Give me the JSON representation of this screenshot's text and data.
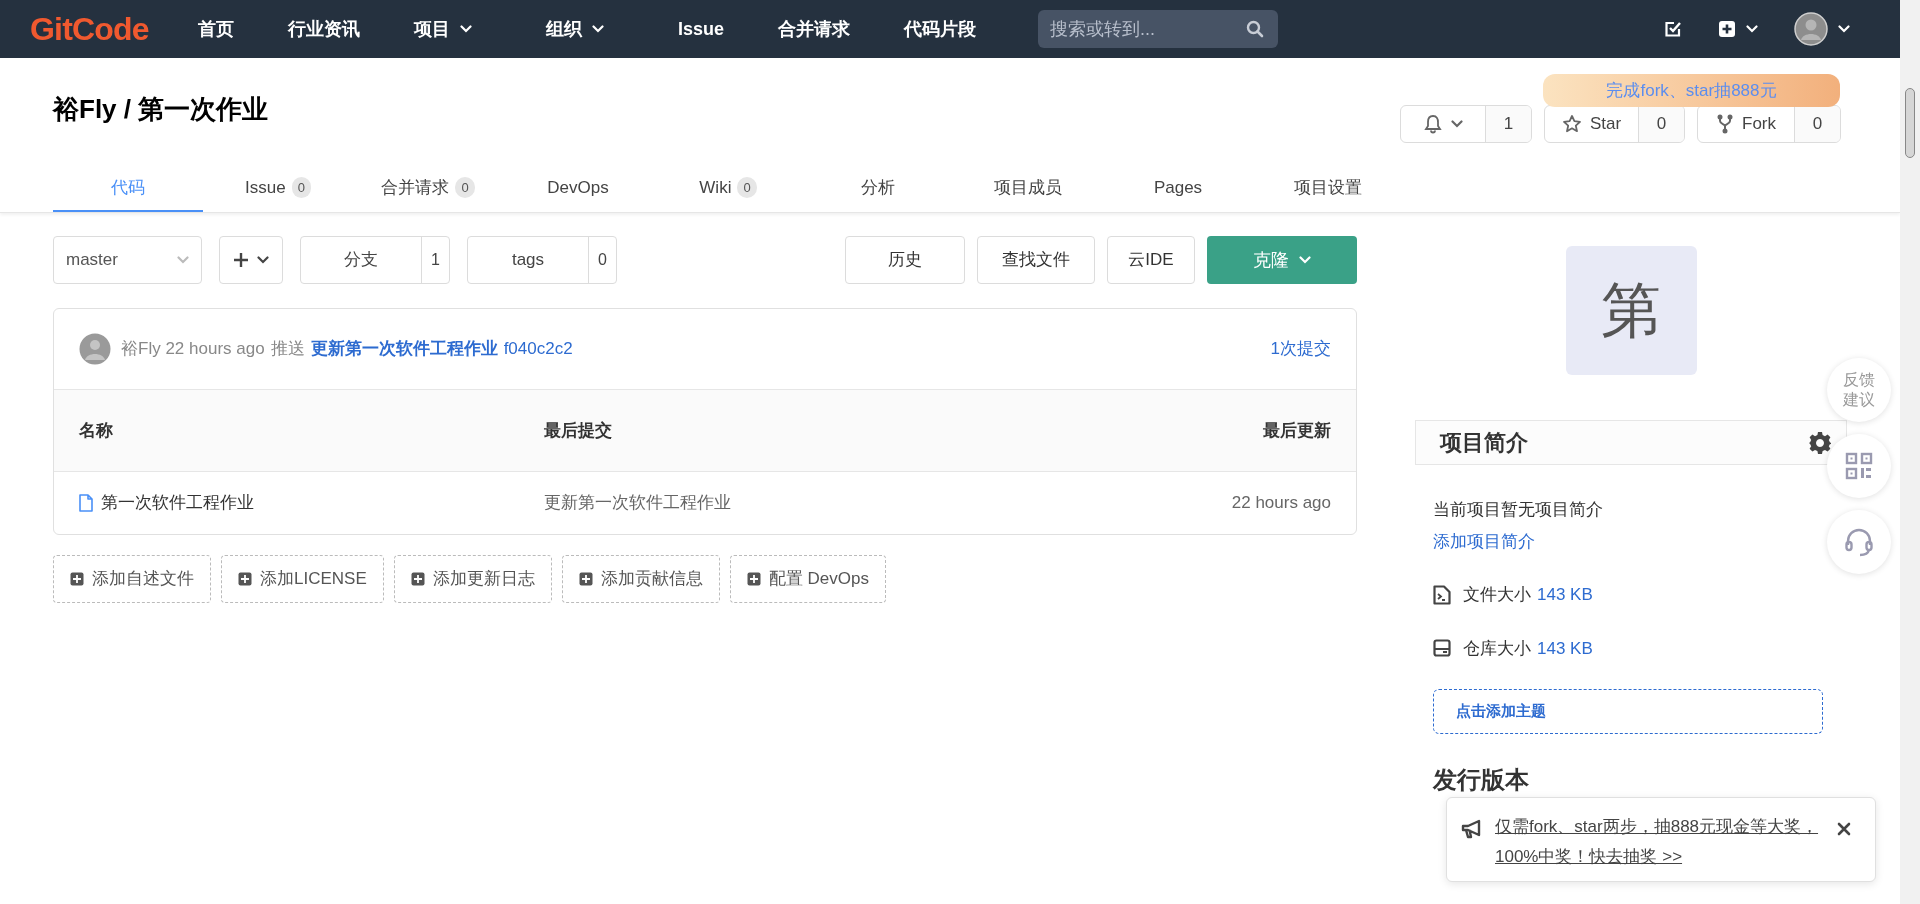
{
  "nav": {
    "logo": "GitCode",
    "items": [
      {
        "label": "首页",
        "dropdown": false
      },
      {
        "label": "行业资讯",
        "dropdown": false
      },
      {
        "label": "项目",
        "dropdown": true
      },
      {
        "label": "组织",
        "dropdown": true
      },
      {
        "label": "Issue",
        "dropdown": false
      },
      {
        "label": "合并请求",
        "dropdown": false
      },
      {
        "label": "代码片段",
        "dropdown": false
      }
    ],
    "search": {
      "placeholder": "搜索或转到..."
    }
  },
  "repo": {
    "title": "裕Fly / 第一次作业",
    "promo": "完成fork、star抽888元",
    "watch": {
      "count": "1"
    },
    "star": {
      "label": "Star",
      "count": "0"
    },
    "fork": {
      "label": "Fork",
      "count": "0"
    }
  },
  "tabs": [
    {
      "label": "代码",
      "selected": true
    },
    {
      "label": "Issue",
      "count": "0",
      "selected": false
    },
    {
      "label": "合并请求",
      "count": "0",
      "selected": false
    },
    {
      "label": "DevOps",
      "selected": false
    },
    {
      "label": "Wiki",
      "count": "0",
      "selected": false
    },
    {
      "label": "分析",
      "selected": false
    },
    {
      "label": "项目成员",
      "selected": false
    },
    {
      "label": "Pages",
      "selected": false
    },
    {
      "label": "项目设置",
      "selected": false
    }
  ],
  "toolbar": {
    "branch": "master",
    "branches": {
      "label": "分支",
      "count": "1"
    },
    "tags": {
      "label": "tags",
      "count": "0"
    },
    "buttons": [
      "历史",
      "查找文件",
      "云IDE"
    ],
    "clone": "克隆"
  },
  "commit": {
    "author": "裕Fly",
    "time": "22 hours ago",
    "action": "推送",
    "message": "更新第一次软件工程作业",
    "hash": "f040c2c2",
    "count": "1次提交"
  },
  "table": {
    "columns": [
      "名称",
      "最后提交",
      "最后更新"
    ],
    "rows": [
      {
        "name": "第一次软件工程作业",
        "commit": "更新第一次软件工程作业",
        "updated": "22 hours ago"
      }
    ]
  },
  "add_buttons": [
    "添加自述文件",
    "添加LICENSE",
    "添加更新日志",
    "添加贡献信息",
    "配置 DevOps"
  ],
  "sidebar": {
    "avatar": "第",
    "about": {
      "title": "项目简介",
      "empty": "当前项目暂无项目简介",
      "link": "添加项目简介"
    },
    "stats": [
      {
        "kind": "file",
        "label": "文件大小",
        "value": "143 KB"
      },
      {
        "kind": "repo",
        "label": "仓库大小",
        "value": "143 KB"
      }
    ],
    "topics": "点击添加主题",
    "releases_title": "发行版本"
  },
  "float_buttons": [
    {
      "kind": "text",
      "label": "反馈建议"
    },
    {
      "kind": "qr"
    },
    {
      "kind": "headset"
    }
  ],
  "notice": {
    "text": "仅需fork、star两步，抽888元现金等大奖，100%中奖！快去抽奖 >>"
  }
}
